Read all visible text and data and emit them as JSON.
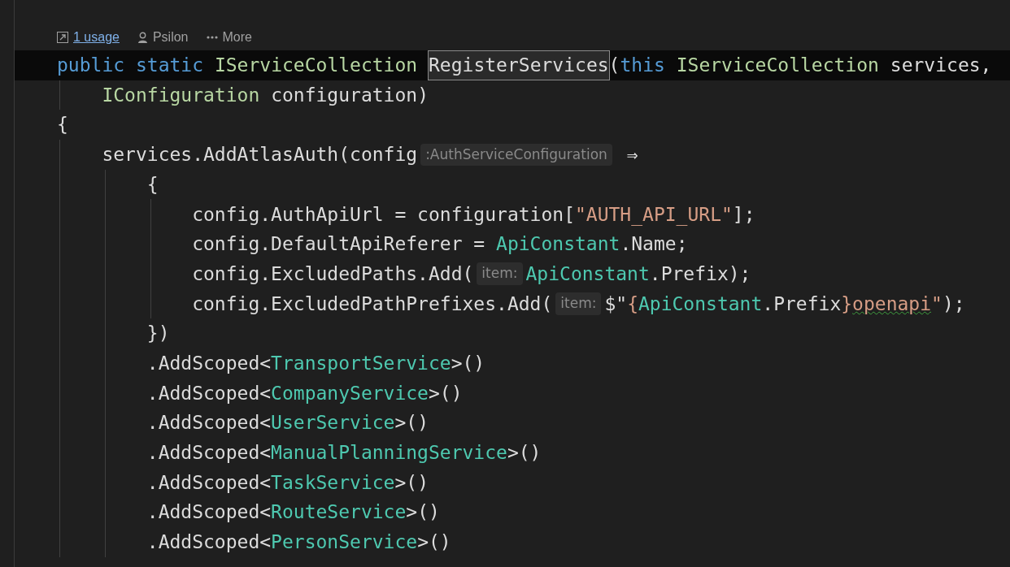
{
  "code_lens": {
    "usages": "1 usage",
    "author": "Psilon",
    "more": "More"
  },
  "lines": [
    {
      "current": true,
      "tokens": [
        {
          "kind": "keyword",
          "text": "public "
        },
        {
          "kind": "keyword",
          "text": "static "
        },
        {
          "kind": "interface",
          "text": "IServiceCollection "
        },
        {
          "kind": "selected",
          "text": "RegisterServices"
        },
        {
          "kind": "plain",
          "text": "("
        },
        {
          "kind": "keyword",
          "text": "this "
        },
        {
          "kind": "interface",
          "text": "IServiceCollection"
        },
        {
          "kind": "plain",
          "text": " services,"
        }
      ]
    },
    {
      "current": false,
      "tokens": [
        {
          "kind": "interface",
          "text": "    IConfiguration"
        },
        {
          "kind": "plain",
          "text": " configuration)"
        }
      ]
    },
    {
      "current": false,
      "tokens": [
        {
          "kind": "plain",
          "text": "{"
        }
      ]
    },
    {
      "current": false,
      "tokens": [
        {
          "kind": "plain",
          "text": "    services.AddAtlasAuth(config"
        },
        {
          "kind": "hint",
          "text": ":AuthServiceConfiguration"
        },
        {
          "kind": "plain",
          "text": " ⇒"
        }
      ]
    },
    {
      "current": false,
      "tokens": [
        {
          "kind": "plain",
          "text": "        {"
        }
      ]
    },
    {
      "current": false,
      "tokens": [
        {
          "kind": "plain",
          "text": "            config.AuthApiUrl = configuration["
        },
        {
          "kind": "string",
          "text": "\"AUTH_API_URL\""
        },
        {
          "kind": "plain",
          "text": "];"
        }
      ]
    },
    {
      "current": false,
      "tokens": [
        {
          "kind": "plain",
          "text": "            config.DefaultApiReferer = "
        },
        {
          "kind": "class",
          "text": "ApiConstant"
        },
        {
          "kind": "plain",
          "text": ".Name;"
        }
      ]
    },
    {
      "current": false,
      "tokens": [
        {
          "kind": "plain",
          "text": "            config.ExcludedPaths.Add("
        },
        {
          "kind": "hint",
          "text": "item:"
        },
        {
          "kind": "class",
          "text": "ApiConstant"
        },
        {
          "kind": "plain",
          "text": ".Prefix);"
        }
      ]
    },
    {
      "current": false,
      "tokens": [
        {
          "kind": "plain",
          "text": "            config.ExcludedPathPrefixes.Add("
        },
        {
          "kind": "hint",
          "text": "item:"
        },
        {
          "kind": "plain",
          "text": "$\""
        },
        {
          "kind": "string",
          "text": "{"
        },
        {
          "kind": "class",
          "text": "ApiConstant"
        },
        {
          "kind": "plain",
          "text": ".Prefix"
        },
        {
          "kind": "string",
          "text": "}"
        },
        {
          "kind": "squiggle",
          "text": "openapi"
        },
        {
          "kind": "string",
          "text": "\""
        },
        {
          "kind": "plain",
          "text": ");"
        }
      ]
    },
    {
      "current": false,
      "tokens": [
        {
          "kind": "plain",
          "text": "        })"
        }
      ]
    },
    {
      "current": false,
      "tokens": [
        {
          "kind": "plain",
          "text": "        .AddScoped<"
        },
        {
          "kind": "class",
          "text": "TransportService"
        },
        {
          "kind": "plain",
          "text": ">()"
        }
      ]
    },
    {
      "current": false,
      "tokens": [
        {
          "kind": "plain",
          "text": "        .AddScoped<"
        },
        {
          "kind": "class",
          "text": "CompanyService"
        },
        {
          "kind": "plain",
          "text": ">()"
        }
      ]
    },
    {
      "current": false,
      "tokens": [
        {
          "kind": "plain",
          "text": "        .AddScoped<"
        },
        {
          "kind": "class",
          "text": "UserService"
        },
        {
          "kind": "plain",
          "text": ">()"
        }
      ]
    },
    {
      "current": false,
      "tokens": [
        {
          "kind": "plain",
          "text": "        .AddScoped<"
        },
        {
          "kind": "class",
          "text": "ManualPlanningService"
        },
        {
          "kind": "plain",
          "text": ">()"
        }
      ]
    },
    {
      "current": false,
      "tokens": [
        {
          "kind": "plain",
          "text": "        .AddScoped<"
        },
        {
          "kind": "class",
          "text": "TaskService"
        },
        {
          "kind": "plain",
          "text": ">()"
        }
      ]
    },
    {
      "current": false,
      "tokens": [
        {
          "kind": "plain",
          "text": "        .AddScoped<"
        },
        {
          "kind": "class",
          "text": "RouteService"
        },
        {
          "kind": "plain",
          "text": ">()"
        }
      ]
    },
    {
      "current": false,
      "tokens": [
        {
          "kind": "plain",
          "text": "        .AddScoped<"
        },
        {
          "kind": "class",
          "text": "PersonService"
        },
        {
          "kind": "plain",
          "text": ">()"
        }
      ]
    }
  ]
}
